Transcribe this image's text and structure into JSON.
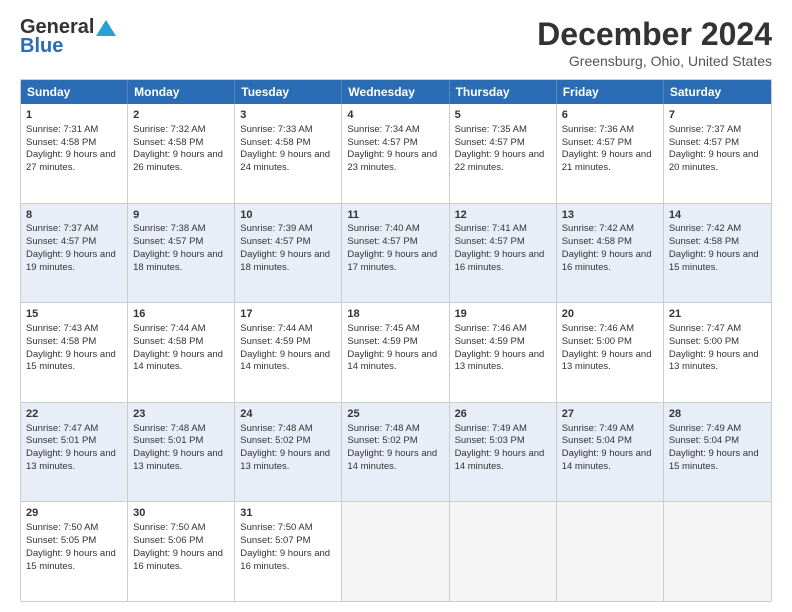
{
  "header": {
    "logo": {
      "line1": "General",
      "line2": "Blue"
    },
    "title": "December 2024",
    "location": "Greensburg, Ohio, United States"
  },
  "calendar": {
    "days": [
      "Sunday",
      "Monday",
      "Tuesday",
      "Wednesday",
      "Thursday",
      "Friday",
      "Saturday"
    ],
    "weeks": [
      [
        {
          "day": "1",
          "sunrise": "Sunrise: 7:31 AM",
          "sunset": "Sunset: 4:58 PM",
          "daylight": "Daylight: 9 hours and 27 minutes."
        },
        {
          "day": "2",
          "sunrise": "Sunrise: 7:32 AM",
          "sunset": "Sunset: 4:58 PM",
          "daylight": "Daylight: 9 hours and 26 minutes."
        },
        {
          "day": "3",
          "sunrise": "Sunrise: 7:33 AM",
          "sunset": "Sunset: 4:58 PM",
          "daylight": "Daylight: 9 hours and 24 minutes."
        },
        {
          "day": "4",
          "sunrise": "Sunrise: 7:34 AM",
          "sunset": "Sunset: 4:57 PM",
          "daylight": "Daylight: 9 hours and 23 minutes."
        },
        {
          "day": "5",
          "sunrise": "Sunrise: 7:35 AM",
          "sunset": "Sunset: 4:57 PM",
          "daylight": "Daylight: 9 hours and 22 minutes."
        },
        {
          "day": "6",
          "sunrise": "Sunrise: 7:36 AM",
          "sunset": "Sunset: 4:57 PM",
          "daylight": "Daylight: 9 hours and 21 minutes."
        },
        {
          "day": "7",
          "sunrise": "Sunrise: 7:37 AM",
          "sunset": "Sunset: 4:57 PM",
          "daylight": "Daylight: 9 hours and 20 minutes."
        }
      ],
      [
        {
          "day": "8",
          "sunrise": "Sunrise: 7:37 AM",
          "sunset": "Sunset: 4:57 PM",
          "daylight": "Daylight: 9 hours and 19 minutes."
        },
        {
          "day": "9",
          "sunrise": "Sunrise: 7:38 AM",
          "sunset": "Sunset: 4:57 PM",
          "daylight": "Daylight: 9 hours and 18 minutes."
        },
        {
          "day": "10",
          "sunrise": "Sunrise: 7:39 AM",
          "sunset": "Sunset: 4:57 PM",
          "daylight": "Daylight: 9 hours and 18 minutes."
        },
        {
          "day": "11",
          "sunrise": "Sunrise: 7:40 AM",
          "sunset": "Sunset: 4:57 PM",
          "daylight": "Daylight: 9 hours and 17 minutes."
        },
        {
          "day": "12",
          "sunrise": "Sunrise: 7:41 AM",
          "sunset": "Sunset: 4:57 PM",
          "daylight": "Daylight: 9 hours and 16 minutes."
        },
        {
          "day": "13",
          "sunrise": "Sunrise: 7:42 AM",
          "sunset": "Sunset: 4:58 PM",
          "daylight": "Daylight: 9 hours and 16 minutes."
        },
        {
          "day": "14",
          "sunrise": "Sunrise: 7:42 AM",
          "sunset": "Sunset: 4:58 PM",
          "daylight": "Daylight: 9 hours and 15 minutes."
        }
      ],
      [
        {
          "day": "15",
          "sunrise": "Sunrise: 7:43 AM",
          "sunset": "Sunset: 4:58 PM",
          "daylight": "Daylight: 9 hours and 15 minutes."
        },
        {
          "day": "16",
          "sunrise": "Sunrise: 7:44 AM",
          "sunset": "Sunset: 4:58 PM",
          "daylight": "Daylight: 9 hours and 14 minutes."
        },
        {
          "day": "17",
          "sunrise": "Sunrise: 7:44 AM",
          "sunset": "Sunset: 4:59 PM",
          "daylight": "Daylight: 9 hours and 14 minutes."
        },
        {
          "day": "18",
          "sunrise": "Sunrise: 7:45 AM",
          "sunset": "Sunset: 4:59 PM",
          "daylight": "Daylight: 9 hours and 14 minutes."
        },
        {
          "day": "19",
          "sunrise": "Sunrise: 7:46 AM",
          "sunset": "Sunset: 4:59 PM",
          "daylight": "Daylight: 9 hours and 13 minutes."
        },
        {
          "day": "20",
          "sunrise": "Sunrise: 7:46 AM",
          "sunset": "Sunset: 5:00 PM",
          "daylight": "Daylight: 9 hours and 13 minutes."
        },
        {
          "day": "21",
          "sunrise": "Sunrise: 7:47 AM",
          "sunset": "Sunset: 5:00 PM",
          "daylight": "Daylight: 9 hours and 13 minutes."
        }
      ],
      [
        {
          "day": "22",
          "sunrise": "Sunrise: 7:47 AM",
          "sunset": "Sunset: 5:01 PM",
          "daylight": "Daylight: 9 hours and 13 minutes."
        },
        {
          "day": "23",
          "sunrise": "Sunrise: 7:48 AM",
          "sunset": "Sunset: 5:01 PM",
          "daylight": "Daylight: 9 hours and 13 minutes."
        },
        {
          "day": "24",
          "sunrise": "Sunrise: 7:48 AM",
          "sunset": "Sunset: 5:02 PM",
          "daylight": "Daylight: 9 hours and 13 minutes."
        },
        {
          "day": "25",
          "sunrise": "Sunrise: 7:48 AM",
          "sunset": "Sunset: 5:02 PM",
          "daylight": "Daylight: 9 hours and 14 minutes."
        },
        {
          "day": "26",
          "sunrise": "Sunrise: 7:49 AM",
          "sunset": "Sunset: 5:03 PM",
          "daylight": "Daylight: 9 hours and 14 minutes."
        },
        {
          "day": "27",
          "sunrise": "Sunrise: 7:49 AM",
          "sunset": "Sunset: 5:04 PM",
          "daylight": "Daylight: 9 hours and 14 minutes."
        },
        {
          "day": "28",
          "sunrise": "Sunrise: 7:49 AM",
          "sunset": "Sunset: 5:04 PM",
          "daylight": "Daylight: 9 hours and 15 minutes."
        }
      ],
      [
        {
          "day": "29",
          "sunrise": "Sunrise: 7:50 AM",
          "sunset": "Sunset: 5:05 PM",
          "daylight": "Daylight: 9 hours and 15 minutes."
        },
        {
          "day": "30",
          "sunrise": "Sunrise: 7:50 AM",
          "sunset": "Sunset: 5:06 PM",
          "daylight": "Daylight: 9 hours and 16 minutes."
        },
        {
          "day": "31",
          "sunrise": "Sunrise: 7:50 AM",
          "sunset": "Sunset: 5:07 PM",
          "daylight": "Daylight: 9 hours and 16 minutes."
        },
        null,
        null,
        null,
        null
      ]
    ]
  }
}
